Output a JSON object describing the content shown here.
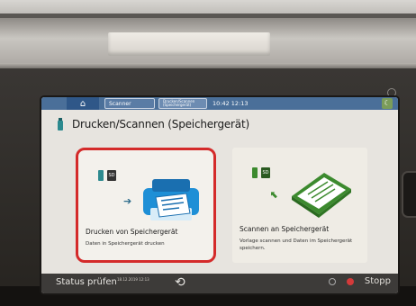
{
  "topbar": {
    "home_label": "⌂",
    "tab_scanner": "Scanner",
    "tab_small": "Drucken/Scannen (Speichergerät)",
    "time": "10:42 12:13"
  },
  "main": {
    "title": "Drucken/Scannen (Speichergerät)",
    "cards": [
      {
        "title": "Drucken von Speichergerät",
        "subtitle": "Daten in Speichergerät drucken"
      },
      {
        "title": "Scannen an Speichergerät",
        "subtitle": "Vorlage scannen und Daten im Speichergerät speichern."
      }
    ]
  },
  "bottombar": {
    "status_label": "Status prüfen",
    "small_time": "18.12.2019 12:13",
    "stop_label": "Stopp"
  },
  "colors": {
    "accent_blue": "#4a6f99",
    "selection_red": "#d42a2a",
    "usb_teal": "#2d8a8f",
    "scanner_green": "#3c8a2e"
  }
}
